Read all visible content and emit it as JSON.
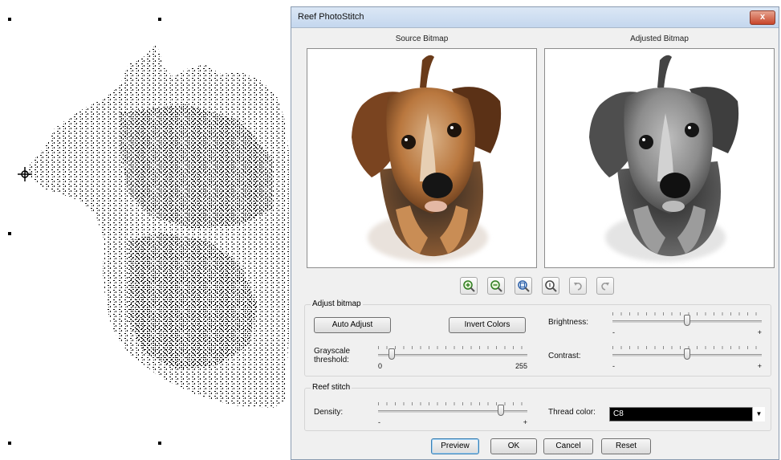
{
  "dialog": {
    "title": "Reef PhotoStitch",
    "close_glyph": "x"
  },
  "panes": {
    "source_label": "Source Bitmap",
    "adjusted_label": "Adjusted Bitmap"
  },
  "toolbar": {
    "icons": [
      "zoom-in-icon",
      "zoom-out-icon",
      "zoom-fit-icon",
      "zoom-actual-icon",
      "undo-icon",
      "redo-icon"
    ]
  },
  "adjust_bitmap": {
    "group_label": "Adjust bitmap",
    "auto_adjust_label": "Auto Adjust",
    "invert_colors_label": "Invert Colors",
    "brightness_label": "Brightness:",
    "brightness_min": "-",
    "brightness_max": "+",
    "brightness_value": 0.5,
    "contrast_label": "Contrast:",
    "contrast_min": "-",
    "contrast_max": "+",
    "contrast_value": 0.5,
    "grayscale_label_line1": "Grayscale",
    "grayscale_label_line2": "threshold:",
    "grayscale_min": "0",
    "grayscale_max": "255",
    "grayscale_value": 0.09
  },
  "reef_stitch": {
    "group_label": "Reef stitch",
    "density_label": "Density:",
    "density_min": "-",
    "density_max": "+",
    "density_value": 0.82,
    "thread_color_label": "Thread color:",
    "thread_color_value": "C8",
    "thread_color_hex": "#000000"
  },
  "buttons": {
    "preview": "Preview",
    "ok": "OK",
    "cancel": "Cancel",
    "reset": "Reset"
  }
}
